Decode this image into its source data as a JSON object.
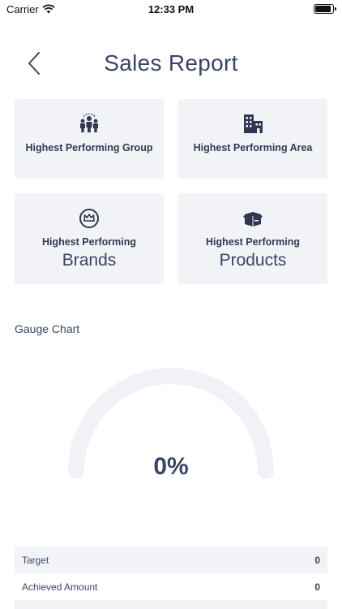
{
  "status_bar": {
    "carrier": "Carrier",
    "time": "12:33 PM"
  },
  "header": {
    "title": "Sales Report"
  },
  "cards": [
    {
      "label": "Highest Performing Group",
      "icon": "group-icon"
    },
    {
      "label": "Highest Performing Area",
      "icon": "buildings-icon"
    },
    {
      "label_top": "Highest Performing",
      "label_big": "Brands",
      "icon": "crown-icon"
    },
    {
      "label_top": "Highest Performing",
      "label_big": "Products",
      "icon": "box-icon"
    }
  ],
  "gauge": {
    "heading": "Gauge Chart",
    "value_text": "0%",
    "value": 0
  },
  "summary": [
    {
      "label": "Target",
      "value": "0"
    },
    {
      "label": "Achieved Amount",
      "value": "0"
    }
  ],
  "colors": {
    "card_bg": "#f2f3f6",
    "text": "#3a4565",
    "gauge_track": "#f1f2f7"
  }
}
